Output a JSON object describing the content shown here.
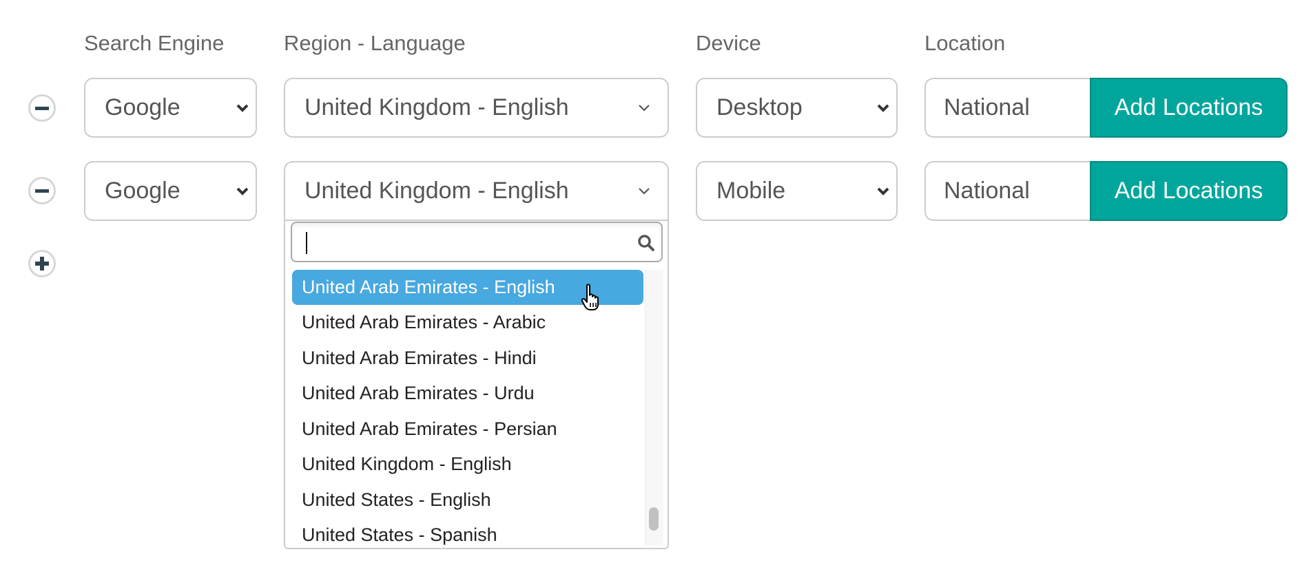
{
  "headers": {
    "search_engine": "Search Engine",
    "region_language": "Region - Language",
    "device": "Device",
    "location": "Location"
  },
  "rows": [
    {
      "search_engine": "Google",
      "region_language": "United Kingdom - English",
      "device": "Desktop",
      "location": "National",
      "add_locations_label": "Add Locations"
    },
    {
      "search_engine": "Google",
      "region_language": "United Kingdom - English",
      "device": "Mobile",
      "location": "National",
      "add_locations_label": "Add Locations"
    }
  ],
  "dropdown": {
    "search_value": "",
    "options": [
      "United Arab Emirates - English",
      "United Arab Emirates - Arabic",
      "United Arab Emirates - Hindi",
      "United Arab Emirates - Urdu",
      "United Arab Emirates - Persian",
      "United Kingdom - English",
      "United States - English",
      "United States - Spanish"
    ],
    "highlighted_index": 0
  },
  "icons": {
    "remove_row": "minus-circle-icon",
    "add_row": "plus-circle-icon",
    "search": "search-icon",
    "cursor": "hand-pointer-icon"
  },
  "colors": {
    "accent": "#00a69c",
    "highlight": "#48a8e0"
  }
}
